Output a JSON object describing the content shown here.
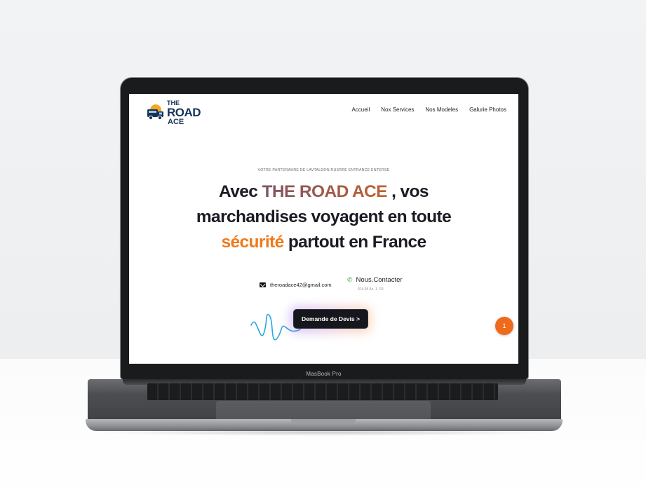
{
  "device": {
    "model_label": "MasBook Pro"
  },
  "logo": {
    "line1": "THE",
    "line2": "ROAD",
    "line3": "ACE"
  },
  "nav": {
    "items": [
      "Accueil",
      "Nox Services",
      "Nos Modeles",
      "Galurie  Photos"
    ]
  },
  "hero": {
    "kicker": "VOTRE PARTERAHRE DE LAVTALDON RUSRRE ENTRANCE ENTERSE",
    "headline_part1": "Avec ",
    "headline_brand": "THE ROAD ACE",
    "headline_part2": " , vos",
    "headline_line2": "marchandises voyagent en toute",
    "headline_highlight": "sécurité",
    "headline_part3": " partout en France"
  },
  "contact": {
    "email": "theroadace42@gmail.com",
    "contact_label": "Nous.Contacter",
    "phone": "814.95 Az. 1. S3"
  },
  "cta": {
    "label": "Demande de Devis >"
  },
  "fab": {
    "label": "1"
  },
  "colors": {
    "accent_orange": "#f07a1a",
    "brand_navy": "#16335a",
    "cta_dark": "#15171d"
  }
}
